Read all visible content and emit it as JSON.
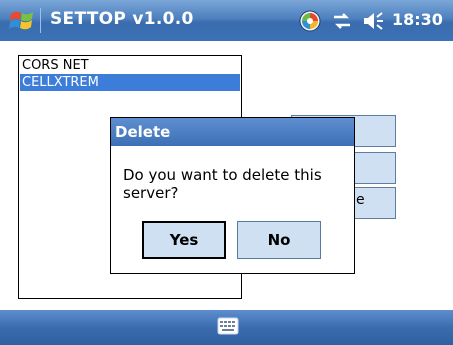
{
  "titlebar": {
    "app_title": "SETTOP v1.0.0",
    "clock": "18:30",
    "icons": [
      "windows-start-icon",
      "sync-status-icon",
      "connectivity-icon",
      "volume-icon"
    ]
  },
  "server_list": {
    "items": [
      {
        "label": "CORS NET",
        "selected": false
      },
      {
        "label": "CELLXTREM",
        "selected": true
      }
    ]
  },
  "side_buttons": {
    "partial_label": "e"
  },
  "dialog": {
    "title": "Delete",
    "message": "Do you want to delete this server?",
    "yes_label": "Yes",
    "no_label": "No"
  },
  "bottombar": {
    "icons": [
      "keyboard-icon"
    ]
  },
  "colors": {
    "selection": "#3b7dd8",
    "titlebar": "#3a6cae",
    "button_face": "#cfe0f2"
  }
}
